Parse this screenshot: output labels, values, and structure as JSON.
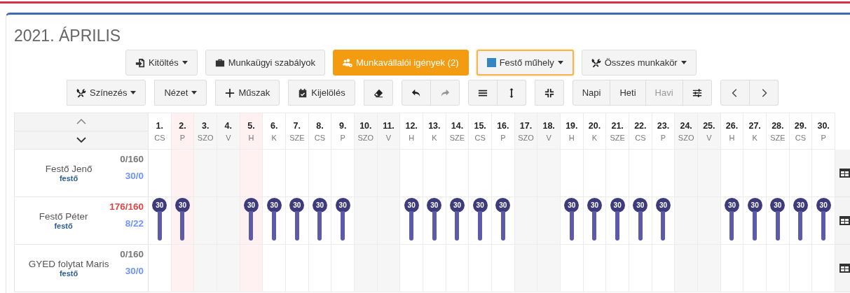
{
  "title": "2021. ÁPRILIS",
  "toolbar_top": [
    {
      "label": "Kitöltés",
      "kind": "default",
      "caret": true,
      "focused": false
    },
    {
      "label": "Munkaügyi szabályok",
      "kind": "default",
      "caret": false,
      "focused": false
    },
    {
      "label": "Munkavállalói igények (2)",
      "kind": "warning",
      "caret": false,
      "focused": false
    },
    {
      "label": "Festő műhely",
      "kind": "default",
      "caret": true,
      "focused": true
    },
    {
      "label": "Összes munkakör",
      "kind": "default",
      "caret": true,
      "focused": false
    }
  ],
  "toolbar_bottom": [
    {
      "buttons": [
        {
          "label": "Színezés",
          "caret": true,
          "disabled": false
        }
      ]
    },
    {
      "buttons": [
        {
          "label": "Nézet",
          "caret": true,
          "disabled": false
        }
      ]
    },
    {
      "buttons": [
        {
          "label": "Műszak",
          "caret": false,
          "disabled": false
        }
      ]
    },
    {
      "buttons": [
        {
          "label": "Kijelölés",
          "caret": false,
          "disabled": false
        }
      ]
    },
    {
      "buttons": [
        {
          "caret": false,
          "disabled": false
        }
      ]
    },
    {
      "buttons": [
        {
          "caret": false,
          "disabled": false
        },
        {
          "caret": false,
          "disabled": true
        }
      ]
    },
    {
      "buttons": [
        {
          "caret": false,
          "disabled": false
        },
        {
          "caret": false,
          "disabled": false
        }
      ]
    },
    {
      "buttons": [
        {
          "caret": false,
          "disabled": false
        }
      ]
    },
    {
      "buttons": [
        {
          "label": "Napi",
          "caret": false,
          "disabled": false
        },
        {
          "label": "Heti",
          "caret": false,
          "disabled": false
        },
        {
          "label": "Havi",
          "caret": false,
          "disabled": true
        },
        {
          "caret": false,
          "disabled": false
        }
      ]
    },
    {
      "buttons": [
        {
          "caret": false,
          "disabled": false
        },
        {
          "caret": false,
          "disabled": false
        }
      ]
    }
  ],
  "days": [
    {
      "num": "1.",
      "dow": "CS",
      "kind": "workday"
    },
    {
      "num": "2.",
      "dow": "P",
      "kind": "holiday"
    },
    {
      "num": "3.",
      "dow": "SZO",
      "kind": "weekend"
    },
    {
      "num": "4.",
      "dow": "V",
      "kind": "weekend"
    },
    {
      "num": "5.",
      "dow": "H",
      "kind": "holiday"
    },
    {
      "num": "6.",
      "dow": "K",
      "kind": "workday"
    },
    {
      "num": "7.",
      "dow": "SZE",
      "kind": "workday"
    },
    {
      "num": "8.",
      "dow": "CS",
      "kind": "workday"
    },
    {
      "num": "9.",
      "dow": "P",
      "kind": "workday"
    },
    {
      "num": "10.",
      "dow": "SZO",
      "kind": "weekend"
    },
    {
      "num": "11.",
      "dow": "V",
      "kind": "weekend"
    },
    {
      "num": "12.",
      "dow": "H",
      "kind": "workday"
    },
    {
      "num": "13.",
      "dow": "K",
      "kind": "workday"
    },
    {
      "num": "14.",
      "dow": "SZE",
      "kind": "workday"
    },
    {
      "num": "15.",
      "dow": "CS",
      "kind": "workday"
    },
    {
      "num": "16.",
      "dow": "P",
      "kind": "workday"
    },
    {
      "num": "17.",
      "dow": "SZO",
      "kind": "weekend"
    },
    {
      "num": "18.",
      "dow": "V",
      "kind": "weekend"
    },
    {
      "num": "19.",
      "dow": "H",
      "kind": "workday"
    },
    {
      "num": "20.",
      "dow": "K",
      "kind": "workday"
    },
    {
      "num": "21.",
      "dow": "SZE",
      "kind": "workday"
    },
    {
      "num": "22.",
      "dow": "CS",
      "kind": "workday"
    },
    {
      "num": "23.",
      "dow": "P",
      "kind": "workday"
    },
    {
      "num": "24.",
      "dow": "SZO",
      "kind": "weekend"
    },
    {
      "num": "25.",
      "dow": "V",
      "kind": "weekend"
    },
    {
      "num": "26.",
      "dow": "H",
      "kind": "workday"
    },
    {
      "num": "27.",
      "dow": "K",
      "kind": "workday"
    },
    {
      "num": "28.",
      "dow": "SZE",
      "kind": "workday"
    },
    {
      "num": "29.",
      "dow": "CS",
      "kind": "workday"
    },
    {
      "num": "30.",
      "dow": "P",
      "kind": "workday"
    }
  ],
  "employees": [
    {
      "name": "Festő Jenő",
      "role": "festő",
      "hours": "0/160",
      "over": false,
      "balance": "30/0",
      "cells": [
        {
          "shift": false
        },
        {
          "shift": false
        },
        {
          "shift": false
        },
        {
          "shift": false
        },
        {
          "shift": false
        },
        {
          "shift": false
        },
        {
          "shift": false
        },
        {
          "shift": false
        },
        {
          "shift": false
        },
        {
          "shift": false
        },
        {
          "shift": false
        },
        {
          "shift": false
        },
        {
          "shift": false
        },
        {
          "shift": false
        },
        {
          "shift": false
        },
        {
          "shift": false
        },
        {
          "shift": false
        },
        {
          "shift": false
        },
        {
          "shift": false
        },
        {
          "shift": false
        },
        {
          "shift": false
        },
        {
          "shift": false
        },
        {
          "shift": false
        },
        {
          "shift": false
        },
        {
          "shift": false
        },
        {
          "shift": false
        },
        {
          "shift": false
        },
        {
          "shift": false
        },
        {
          "shift": false
        },
        {
          "shift": false
        }
      ]
    },
    {
      "name": "Festő Péter",
      "role": "festő",
      "hours": "176/160",
      "over": true,
      "balance": "8/22",
      "cells": [
        {
          "shift": true,
          "label": "30"
        },
        {
          "shift": true,
          "label": "30"
        },
        {
          "shift": false
        },
        {
          "shift": false
        },
        {
          "shift": true,
          "label": "30"
        },
        {
          "shift": true,
          "label": "30"
        },
        {
          "shift": true,
          "label": "30"
        },
        {
          "shift": true,
          "label": "30"
        },
        {
          "shift": true,
          "label": "30"
        },
        {
          "shift": false
        },
        {
          "shift": false
        },
        {
          "shift": true,
          "label": "30"
        },
        {
          "shift": true,
          "label": "30"
        },
        {
          "shift": true,
          "label": "30"
        },
        {
          "shift": true,
          "label": "30"
        },
        {
          "shift": true,
          "label": "30"
        },
        {
          "shift": false
        },
        {
          "shift": false
        },
        {
          "shift": true,
          "label": "30"
        },
        {
          "shift": true,
          "label": "30"
        },
        {
          "shift": true,
          "label": "30"
        },
        {
          "shift": true,
          "label": "30"
        },
        {
          "shift": true,
          "label": "30"
        },
        {
          "shift": false
        },
        {
          "shift": false
        },
        {
          "shift": true,
          "label": "30"
        },
        {
          "shift": true,
          "label": "30"
        },
        {
          "shift": true,
          "label": "30"
        },
        {
          "shift": true,
          "label": "30"
        },
        {
          "shift": true,
          "label": "30"
        }
      ]
    },
    {
      "name": "GYED folytat Maris",
      "role": "festő",
      "hours": "0/160",
      "over": false,
      "balance": "30/0",
      "cells": [
        {
          "shift": false
        },
        {
          "shift": false
        },
        {
          "shift": false
        },
        {
          "shift": false
        },
        {
          "shift": false
        },
        {
          "shift": false
        },
        {
          "shift": false
        },
        {
          "shift": false
        },
        {
          "shift": false
        },
        {
          "shift": false
        },
        {
          "shift": false
        },
        {
          "shift": false
        },
        {
          "shift": false
        },
        {
          "shift": false
        },
        {
          "shift": false
        },
        {
          "shift": false
        },
        {
          "shift": false
        },
        {
          "shift": false
        },
        {
          "shift": false
        },
        {
          "shift": false
        },
        {
          "shift": false
        },
        {
          "shift": false
        },
        {
          "shift": false
        },
        {
          "shift": false
        },
        {
          "shift": false
        },
        {
          "shift": false
        },
        {
          "shift": false
        },
        {
          "shift": false
        },
        {
          "shift": false
        },
        {
          "shift": false
        }
      ]
    }
  ]
}
